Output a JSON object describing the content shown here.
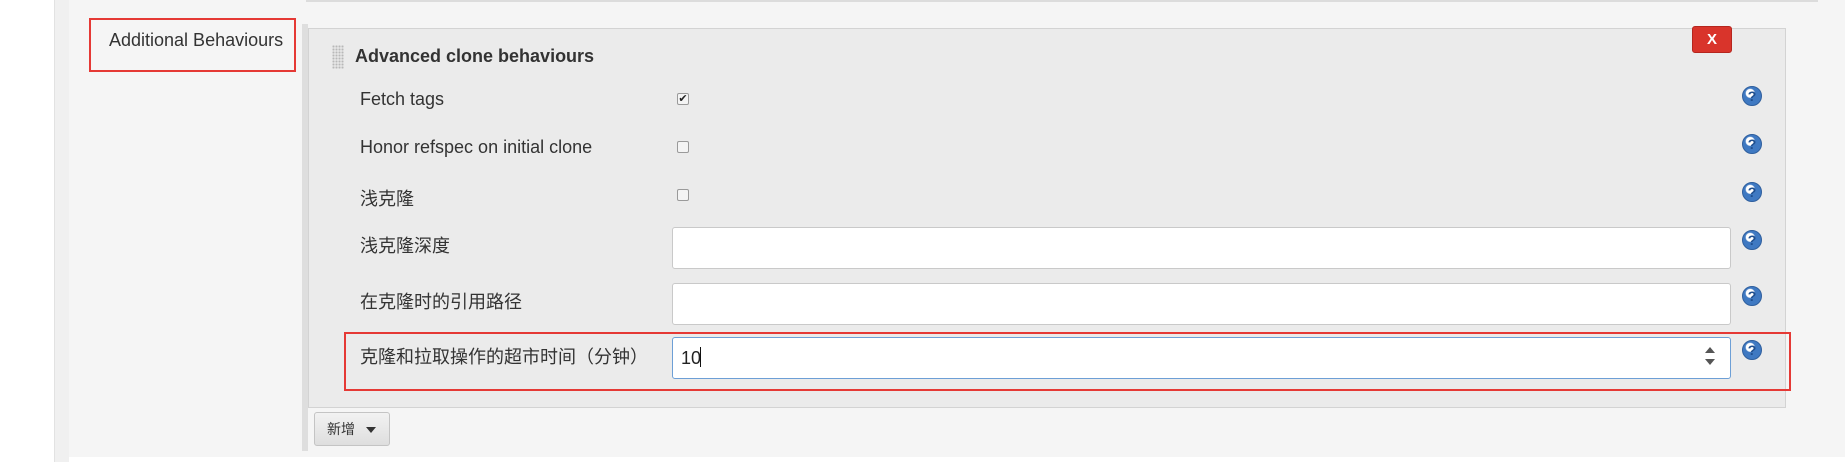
{
  "section": {
    "label": "Additional Behaviours"
  },
  "behaviour": {
    "title": "Advanced clone behaviours",
    "delete_label": "X",
    "rows": [
      {
        "label": "Fetch tags",
        "type": "checkbox",
        "checked": true
      },
      {
        "label": "Honor refspec on initial clone",
        "type": "checkbox",
        "checked": false
      },
      {
        "label": "浅克隆",
        "type": "checkbox",
        "checked": false
      },
      {
        "label": "浅克隆深度",
        "type": "text",
        "value": ""
      },
      {
        "label": "在克隆时的引用路径",
        "type": "text",
        "value": ""
      },
      {
        "label": "克隆和拉取操作的超市时间（分钟）",
        "type": "number",
        "value": "10"
      }
    ],
    "help_icon": "help-icon",
    "check_mark": "✔"
  },
  "add_button": {
    "label": "新增",
    "icon": "caret-down-icon"
  },
  "colors": {
    "annotation": "#e53935",
    "delete_button": "#d9342b",
    "help_icon": "#3f79c2"
  }
}
